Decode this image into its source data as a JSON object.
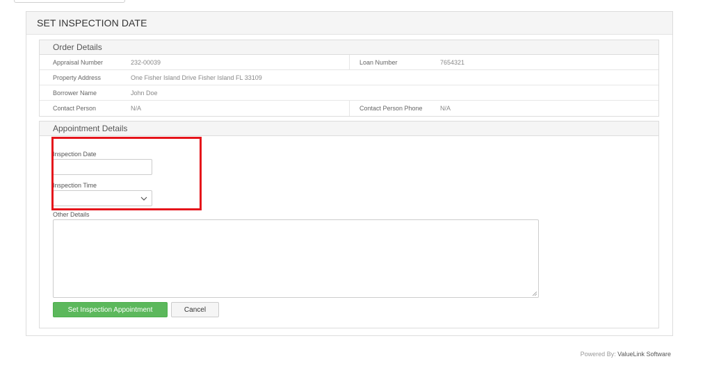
{
  "panel": {
    "title": "SET INSPECTION DATE"
  },
  "order_details": {
    "title": "Order Details",
    "rows": [
      {
        "label": "Appraisal Number",
        "value": "232-00039",
        "right_label": "Loan Number",
        "right_value": "7654321"
      },
      {
        "label": "Property Address",
        "value": "One Fisher Island Drive Fisher Island FL 33109"
      },
      {
        "label": "Borrower Name",
        "value": "John Doe"
      },
      {
        "label": "Contact Person",
        "value": "N/A",
        "right_label": "Contact Person Phone",
        "right_value": "N/A"
      }
    ]
  },
  "appointment": {
    "title": "Appointment Details",
    "inspection_date_label": "Inspection Date",
    "inspection_date_value": "",
    "inspection_time_label": "Inspection Time",
    "inspection_time_value": "",
    "other_details_label": "Other Details",
    "other_details_value": "",
    "submit_label": "Set Inspection Appointment",
    "cancel_label": "Cancel"
  },
  "footer": {
    "prefix": "Powered By: ",
    "brand": "ValueLink Software"
  },
  "colors": {
    "primary": "#5cb85c",
    "highlight": "#e5141b"
  },
  "icons": {
    "select_toggle": "chevron-down-icon",
    "resize": "resize-grip-icon"
  }
}
